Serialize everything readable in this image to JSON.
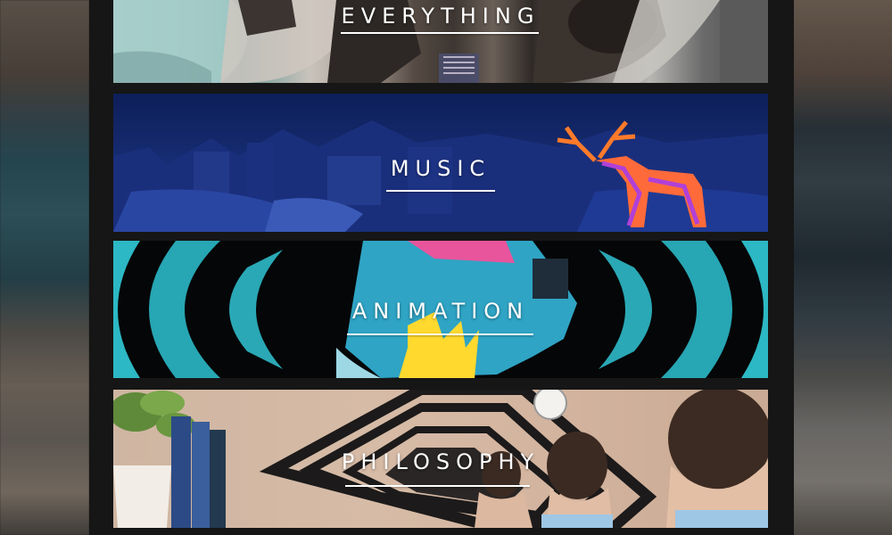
{
  "categories": [
    {
      "label": "EVERYTHING"
    },
    {
      "label": "MUSIC"
    },
    {
      "label": "ANIMATION"
    },
    {
      "label": "PHILOSOPHY"
    }
  ],
  "colors": {
    "frame": "#161616",
    "label": "#ffffff"
  }
}
